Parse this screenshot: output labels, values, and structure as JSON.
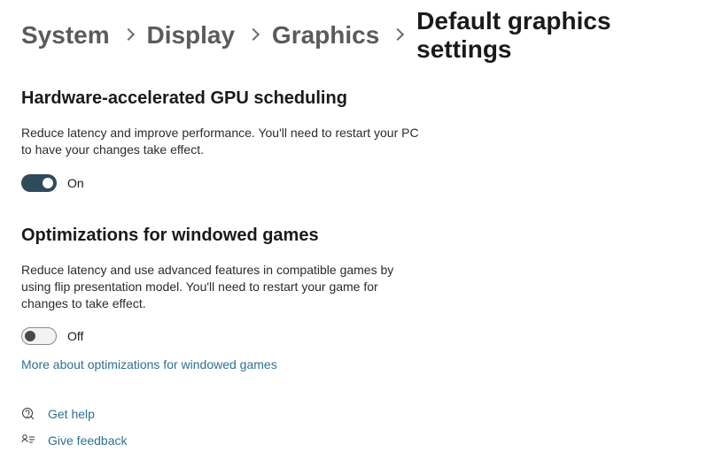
{
  "breadcrumb": {
    "system": "System",
    "display": "Display",
    "graphics": "Graphics",
    "current": "Default graphics settings"
  },
  "gpu_section": {
    "title": "Hardware-accelerated GPU scheduling",
    "desc": "Reduce latency and improve performance. You'll need to restart your PC to have your changes take effect.",
    "toggle_state": "On"
  },
  "windowed_section": {
    "title": "Optimizations for windowed games",
    "desc": "Reduce latency and use advanced features in compatible games by using flip presentation model. You'll need to restart your game for changes to take effect.",
    "toggle_state": "Off",
    "more_link": "More about optimizations for windowed games"
  },
  "footer": {
    "get_help": "Get help",
    "give_feedback": "Give feedback"
  }
}
